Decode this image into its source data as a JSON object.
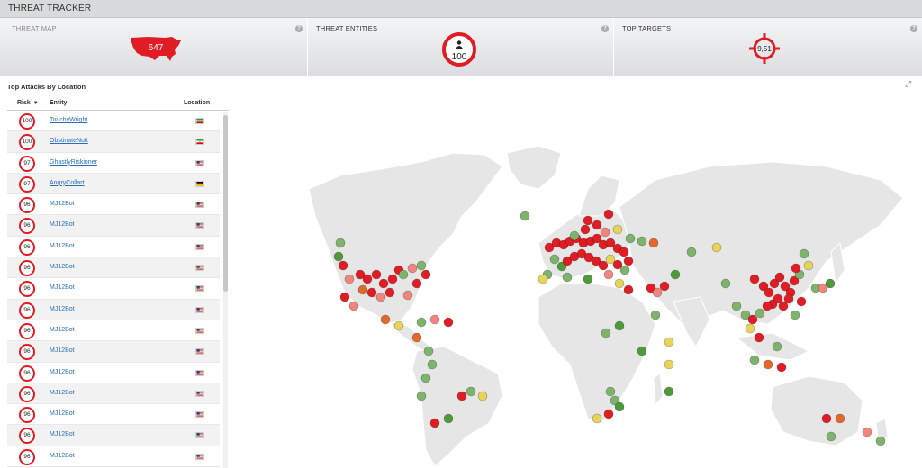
{
  "app": {
    "title": "THREAT TRACKER"
  },
  "tiles": {
    "threat_map": {
      "label": "THREAT MAP",
      "value": "647"
    },
    "threat_entities": {
      "label": "THREAT ENTITIES",
      "value": "100"
    },
    "top_targets": {
      "label": "TOP TARGETS",
      "value": "9,51"
    }
  },
  "table": {
    "title": "Top Attacks By Location",
    "columns": {
      "risk": "Risk",
      "entity": "Entity",
      "location": "Location"
    },
    "sort_indicator": "▼",
    "rows": [
      {
        "risk": "100",
        "entity": "TouchyWright",
        "flag": "iran"
      },
      {
        "risk": "100",
        "entity": "ObstinateNutt",
        "flag": "iran"
      },
      {
        "risk": "97",
        "entity": "GhastlyRiskinner",
        "flag": "us"
      },
      {
        "risk": "97",
        "entity": "AngryCollart",
        "flag": "germany"
      },
      {
        "risk": "96",
        "entity": "MJ12Bot",
        "flag": "us"
      },
      {
        "risk": "96",
        "entity": "MJ12Bot",
        "flag": "us"
      },
      {
        "risk": "96",
        "entity": "MJ12Bot",
        "flag": "us"
      },
      {
        "risk": "96",
        "entity": "MJ12Bot",
        "flag": "us"
      },
      {
        "risk": "96",
        "entity": "MJ12Bot",
        "flag": "us"
      },
      {
        "risk": "96",
        "entity": "MJ12Bot",
        "flag": "us"
      },
      {
        "risk": "96",
        "entity": "MJ12Bot",
        "flag": "us"
      },
      {
        "risk": "96",
        "entity": "MJ12Bot",
        "flag": "us"
      },
      {
        "risk": "96",
        "entity": "MJ12Bot",
        "flag": "us"
      },
      {
        "risk": "96",
        "entity": "MJ12Bot",
        "flag": "us"
      },
      {
        "risk": "96",
        "entity": "MJ12Bot",
        "flag": "us"
      },
      {
        "risk": "96",
        "entity": "MJ12Bot",
        "flag": "us"
      },
      {
        "risk": "96",
        "entity": "MJ12Bot",
        "flag": "us"
      }
    ]
  },
  "colors": {
    "critical": "#e01c24",
    "high": "#f0857d",
    "medium": "#e06a2c",
    "low": "#e7d25a",
    "minimal": "#7db36b",
    "min2": "#4e9a3b",
    "land": "#e6e6e6"
  },
  "icons": {
    "help": "help-icon",
    "expand": "expand-icon",
    "user": "user-icon",
    "target": "crosshair-icon"
  }
}
